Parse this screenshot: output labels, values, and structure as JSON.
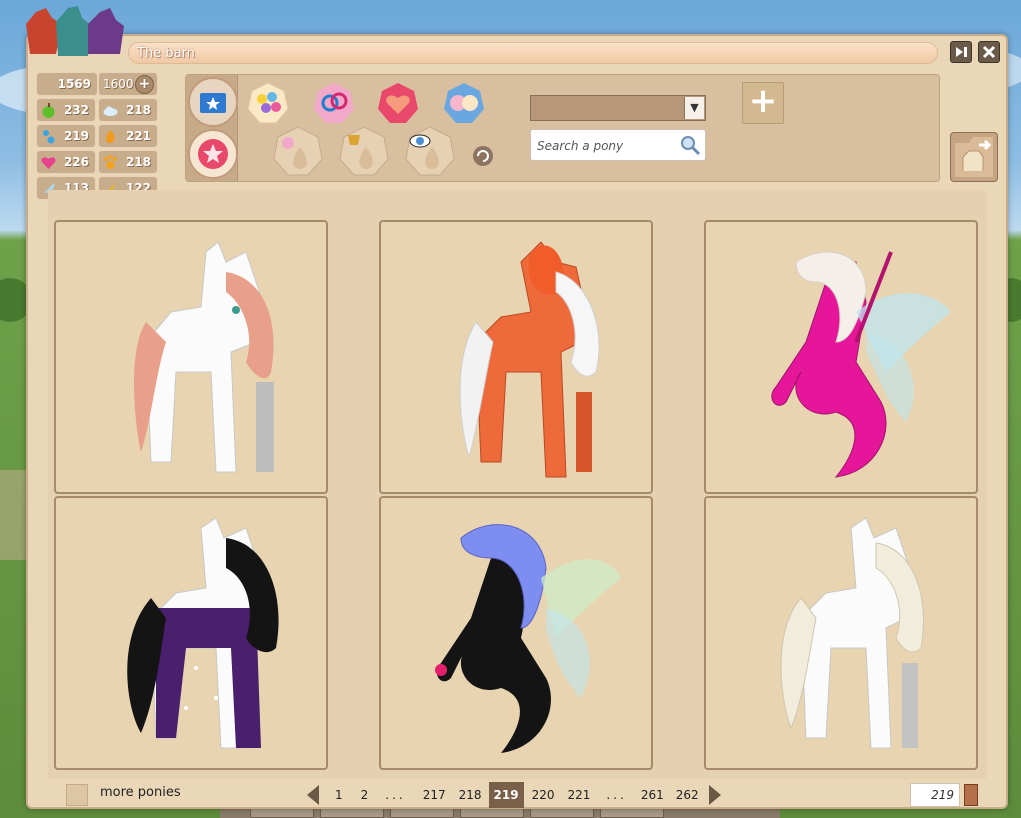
{
  "window": {
    "title": "The barn"
  },
  "stats": {
    "money": "1569",
    "money_max": "1600",
    "rows": [
      {
        "left_icon": "apple-icon",
        "left": "232",
        "right_icon": "cloud-icon",
        "right": "218"
      },
      {
        "left_icon": "pawprint-blue-icon",
        "left": "219",
        "right_icon": "fire-icon",
        "right": "221"
      },
      {
        "left_icon": "heart-icon",
        "left": "226",
        "right_icon": "pawprint-orange-icon",
        "right": "218"
      },
      {
        "left_icon": "feather-icon",
        "left": "113",
        "right_icon": "horn-icon",
        "right": "122"
      }
    ]
  },
  "search": {
    "placeholder": "Search a pony",
    "dropdown_value": ""
  },
  "cards": [
    {
      "name": "pony-white-pink"
    },
    {
      "name": "pony-orange-white"
    },
    {
      "name": "pony-magenta-seapony"
    },
    {
      "name": "pony-purple-starry"
    },
    {
      "name": "pony-black-blue-seapony"
    },
    {
      "name": "pony-white-cream"
    }
  ],
  "footer": {
    "more_label": "more ponies",
    "pages": [
      "1",
      "2",
      "...",
      "217",
      "218",
      "219",
      "220",
      "221",
      "...",
      "261",
      "262"
    ],
    "current_page": "219",
    "page_input": "219"
  },
  "colors": {
    "window_bg": "#e9d7b8",
    "card_border": "#a78a6b",
    "current_page_bg": "#7a6049"
  }
}
